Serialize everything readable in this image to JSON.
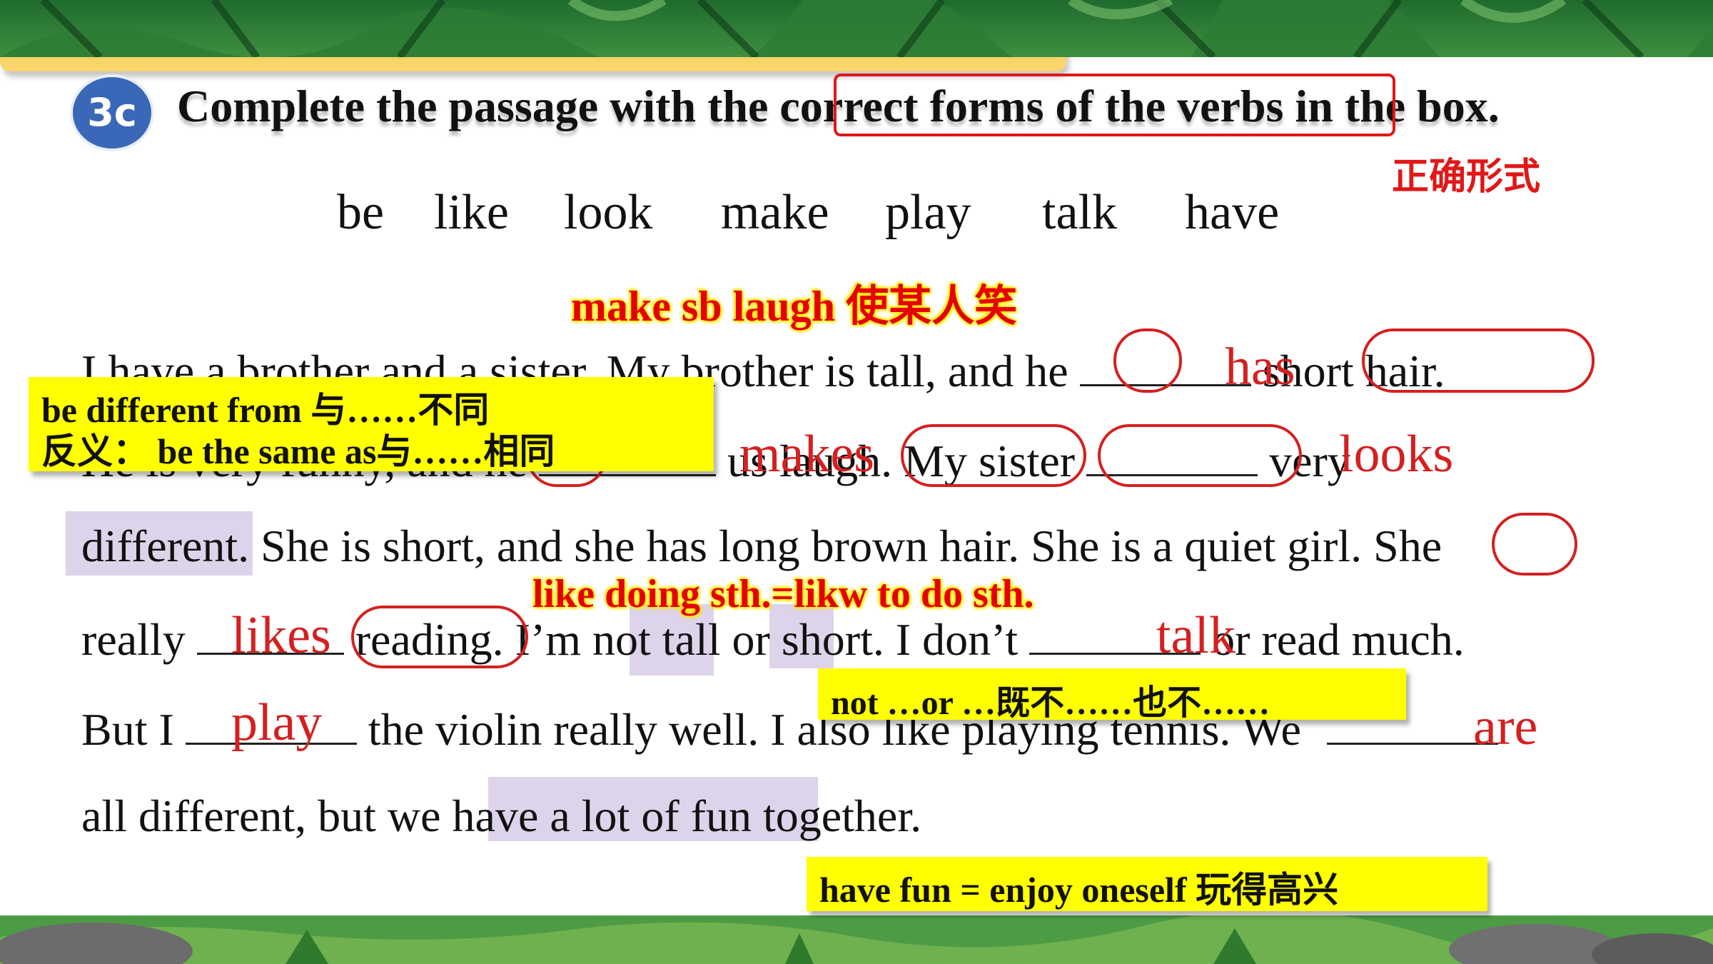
{
  "slide": {
    "badge": "3c",
    "instruction": "Complete the passage with the correct forms of the verbs in the box.",
    "label_correct_forms": "正确形式",
    "word_box": [
      "be",
      "like",
      "look",
      "make",
      "play",
      "talk",
      "have"
    ]
  },
  "notes": {
    "make_laugh": "make sb laugh 使某人笑",
    "be_different_1": "be different from  与……不同",
    "be_different_2": "反义：  be the same as与……相同",
    "like_doing": "like doing sth.=likw to do sth.",
    "not_or": "not …or …既不……也不……",
    "have_fun": "have fun = enjoy oneself  玩得高兴"
  },
  "passage": {
    "line1_a": "I have a brother and a sister. My brother is tall, and he ",
    "line1_b": " short hair.",
    "line2_a": "He is very funny, and he ",
    "line2_b": " us laugh. My sister ",
    "line2_c": " very",
    "line3": "different. She is short, and she has long brown hair. She is a quiet girl. She",
    "line4_a": "really ",
    "line4_b": " reading. I’m not tall or short. I don’t ",
    "line4_c": " or read much.",
    "line5_a": "But I ",
    "line5_b": " the violin really well. I also like playing tennis. We ",
    "line6": "all different, but we have a lot of fun together."
  },
  "answers": {
    "has": "has",
    "makes": "makes",
    "looks": "looks",
    "likes": "likes",
    "talk": "talk",
    "play": "play",
    "are": "are"
  }
}
